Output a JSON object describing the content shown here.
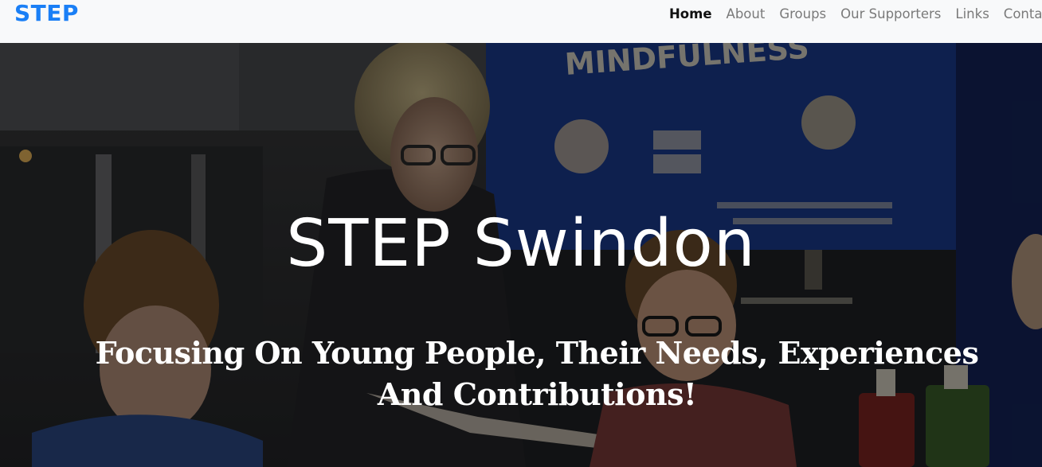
{
  "navbar": {
    "brand": "STEP",
    "links": [
      {
        "label": "Home",
        "active": true
      },
      {
        "label": "About"
      },
      {
        "label": "Groups"
      },
      {
        "label": "Our Supporters"
      },
      {
        "label": "Links"
      },
      {
        "label": "Conta"
      }
    ]
  },
  "hero": {
    "title": "STEP Swindon",
    "subtitle": "Focusing On Young People, Their Needs, Experiences And Contributions!"
  },
  "colors": {
    "brand": "#1a7ff6",
    "navbar_bg": "#f8f9fa",
    "nav_active": "#111111",
    "nav_inactive": "#7a7a7a",
    "hero_text": "#ffffff"
  }
}
